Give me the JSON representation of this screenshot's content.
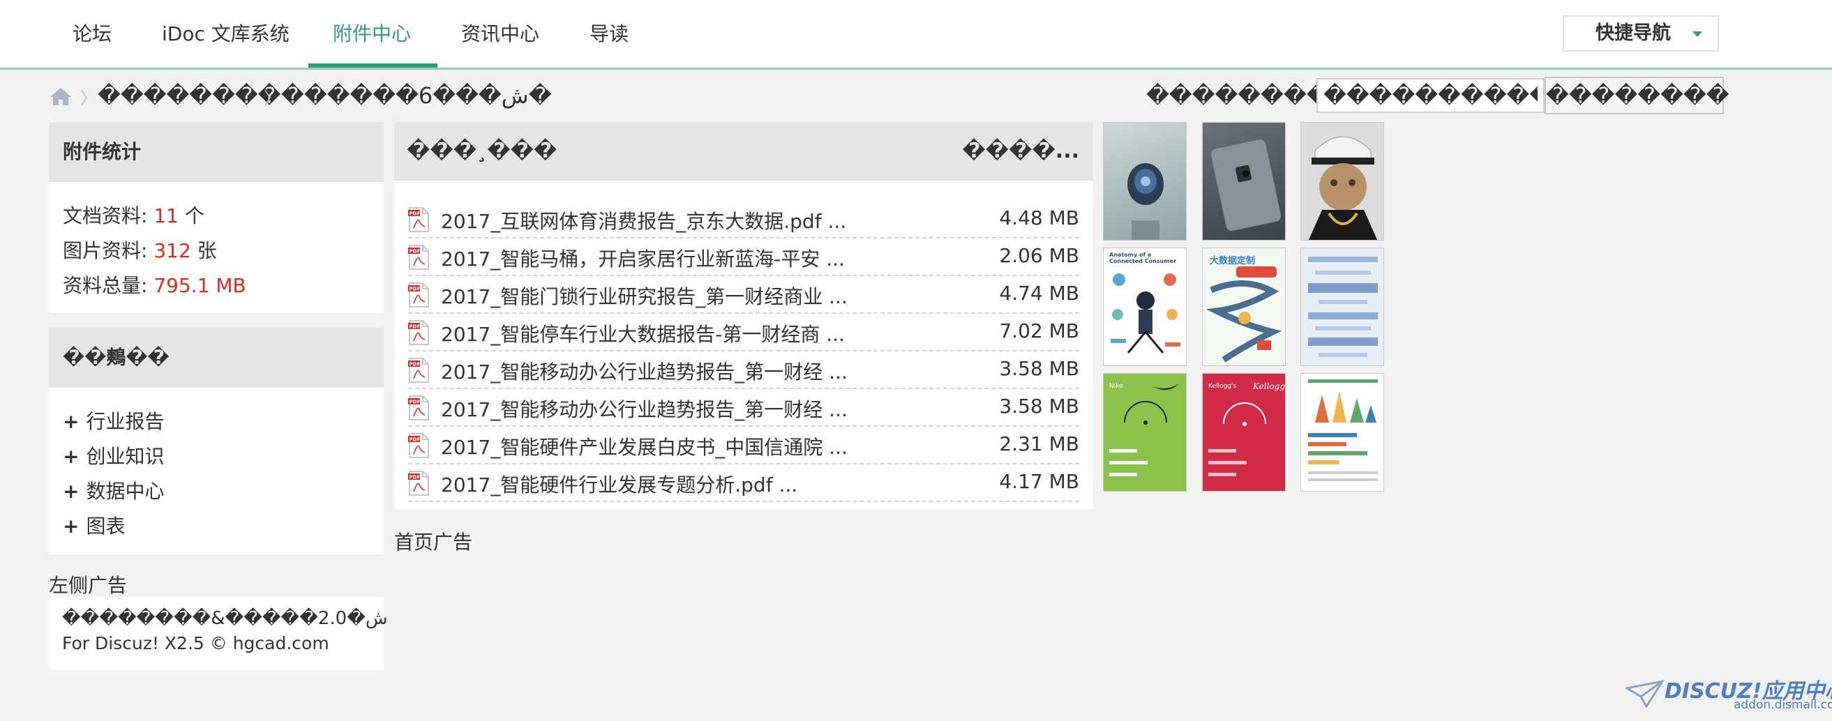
{
  "nav": {
    "items": [
      {
        "label": "论坛"
      },
      {
        "label": "iDoc 文库系统"
      },
      {
        "label": "附件中心",
        "active": true
      },
      {
        "label": "资讯中心"
      },
      {
        "label": "导读"
      }
    ],
    "quick_nav": "快捷导航",
    "accent_color": "#2e9e7c"
  },
  "breadcrumb": {
    "items": [
      "��������",
      "������ش���6�"
    ]
  },
  "search": {
    "label": "��������",
    "value": "����������������",
    "button": "��������"
  },
  "stats_panel": {
    "title": "附件统计",
    "doc_label": "文档资料: ",
    "doc_value": "11",
    "doc_unit": " 个",
    "img_label": "图片资料: ",
    "img_value": "312",
    "img_unit": " 张",
    "total_label": "资料总量: ",
    "total_value": "795.1 MB"
  },
  "category_panel": {
    "title": "��鷞��",
    "items": [
      "行业报告",
      "创业知识",
      "数据中心",
      "图表"
    ]
  },
  "left_ad": "左侧广告",
  "footer": {
    "line1": "��������&�����2.0�ش",
    "line2": "For Discuz! X2.5 © hgcad.com"
  },
  "file_list": {
    "header_left": "���¸���",
    "header_right": "����...",
    "files": [
      {
        "name": "2017_互联网体育消费报告_京东大数据.pdf ...",
        "size": "4.48 MB"
      },
      {
        "name": "2017_智能马桶，开启家居行业新蓝海-平安 ...",
        "size": "2.06 MB"
      },
      {
        "name": "2017_智能门锁行业研究报告_第一财经商业 ...",
        "size": "4.74 MB"
      },
      {
        "name": "2017_智能停车行业大数据报告-第一财经商 ...",
        "size": "7.02 MB"
      },
      {
        "name": "2017_智能移动办公行业趋势报告_第一财经 ...",
        "size": "3.58 MB"
      },
      {
        "name": "2017_智能移动办公行业趋势报告_第一财经 ...",
        "size": "3.58 MB"
      },
      {
        "name": "2017_智能硬件产业发展白皮书_中国信通院 ...",
        "size": "2.31 MB"
      },
      {
        "name": "2017_智能硬件行业发展专题分析.pdf ...",
        "size": "4.17 MB"
      }
    ]
  },
  "home_ad": "首页广告",
  "thumbnails": [
    {
      "subject": "webcam-photo"
    },
    {
      "subject": "smartphone-photo"
    },
    {
      "subject": "cat-in-hat-photo"
    },
    {
      "subject": "connected-consumer-infographic",
      "text": "Anatomy of a Connected Consumer"
    },
    {
      "subject": "big-data-infographic",
      "text": "大数据定制"
    },
    {
      "subject": "blurred-infographic"
    },
    {
      "subject": "nike-infographic",
      "text": "Nike"
    },
    {
      "subject": "kelloggs-infographic",
      "text": "Kellogg's"
    },
    {
      "subject": "chart-infographic"
    }
  ],
  "watermark": {
    "brand": "DISCUZ!应用中心",
    "url": "addon.dismall.com"
  }
}
